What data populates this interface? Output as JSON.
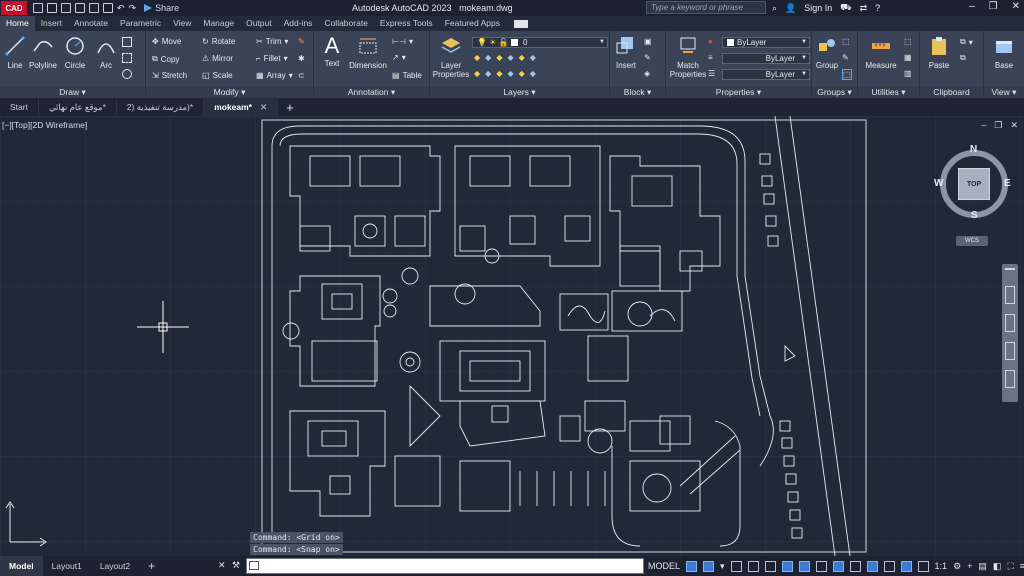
{
  "app": {
    "logo_text": "CAD",
    "title": "Autodesk AutoCAD 2023",
    "file": "mokeam.dwg",
    "share_label": "Share",
    "search_placeholder": "Type a keyword or phrase",
    "sign_in": "Sign In"
  },
  "ribbon_tabs": [
    "Home",
    "Insert",
    "Annotate",
    "Parametric",
    "View",
    "Manage",
    "Output",
    "Add-ins",
    "Collaborate",
    "Express Tools",
    "Featured Apps"
  ],
  "ribbon": {
    "draw": {
      "title": "Draw",
      "line": "Line",
      "polyline": "Polyline",
      "circle": "Circle",
      "arc": "Arc"
    },
    "modify": {
      "title": "Modify",
      "move": "Move",
      "rotate": "Rotate",
      "trim": "Trim",
      "copy": "Copy",
      "mirror": "Mirror",
      "fillet": "Fillet",
      "stretch": "Stretch",
      "scale": "Scale",
      "array": "Array"
    },
    "annotation": {
      "title": "Annotation",
      "text": "Text",
      "dimension": "Dimension",
      "table": "Table"
    },
    "layers": {
      "title": "Layers",
      "layer_properties_1": "Layer",
      "layer_properties_2": "Properties",
      "current_layer": "0"
    },
    "block": {
      "title": "Block",
      "insert": "Insert"
    },
    "properties": {
      "title": "Properties",
      "match_1": "Match",
      "match_2": "Properties",
      "color": "ByLayer",
      "linetype": "ByLayer",
      "lineweight": "ByLayer"
    },
    "groups": {
      "title": "Groups",
      "group": "Group"
    },
    "utilities": {
      "title": "Utilities",
      "measure": "Measure"
    },
    "clipboard": {
      "title": "Clipboard",
      "paste": "Paste"
    },
    "view": {
      "title": "View",
      "base": "Base"
    }
  },
  "file_tabs": {
    "start": "Start",
    "tab1": "موقع عام نهائي*",
    "tab2": "2) مدرسة تنفيذية)*",
    "tab3": "mokeam*"
  },
  "viewport": {
    "label": "[−][Top][2D Wireframe]",
    "viewcube": {
      "top": "TOP",
      "north": "N",
      "south": "S",
      "east": "E",
      "west": "W",
      "wcs": "WCS"
    },
    "command_history": [
      "Command:  <Grid on>",
      "Command:  <Snap on>"
    ]
  },
  "status": {
    "layout_tabs": [
      "Model",
      "Layout1",
      "Layout2"
    ],
    "command_prompt": "",
    "model_label": "MODEL",
    "scale": "1:1"
  },
  "colors": {
    "background": "#212836",
    "ribbon": "#3b4456",
    "drawing_lines": "#e8ecf2",
    "grid": "#2a3242"
  }
}
